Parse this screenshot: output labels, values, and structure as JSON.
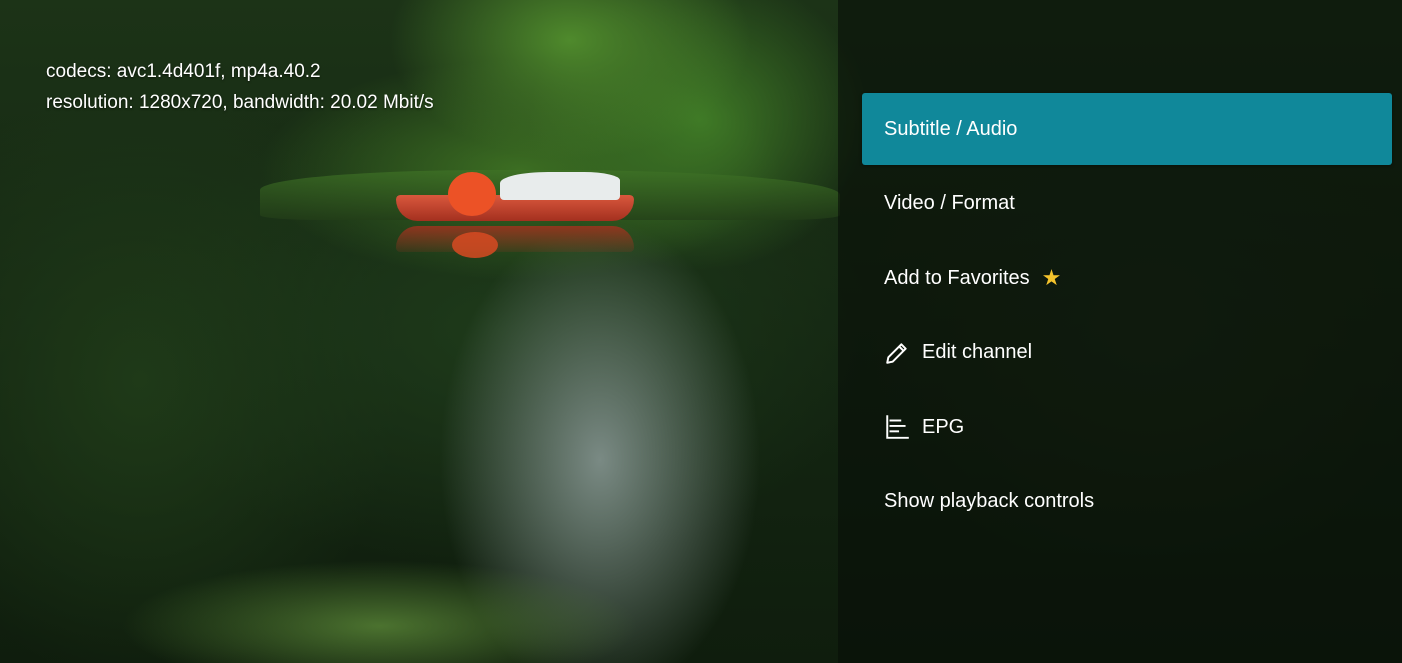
{
  "stats": {
    "codecs_line": "codecs: avc1.4d401f, mp4a.40.2",
    "resolution_line": "resolution: 1280x720, bandwidth: 20.02 Mbit/s"
  },
  "menu": {
    "items": [
      {
        "label": "Subtitle / Audio",
        "selected": true
      },
      {
        "label": "Video / Format"
      },
      {
        "label": "Add to Favorites",
        "icon": "star-icon",
        "icon_glyph": "★"
      },
      {
        "label": "Edit channel",
        "icon": "pencil-icon"
      },
      {
        "label": "EPG",
        "icon": "epg-list-icon"
      },
      {
        "label": "Show playback controls"
      }
    ]
  },
  "colors": {
    "selected_bg": "#10889a",
    "star": "#f5c42c",
    "text": "#ffffff"
  }
}
